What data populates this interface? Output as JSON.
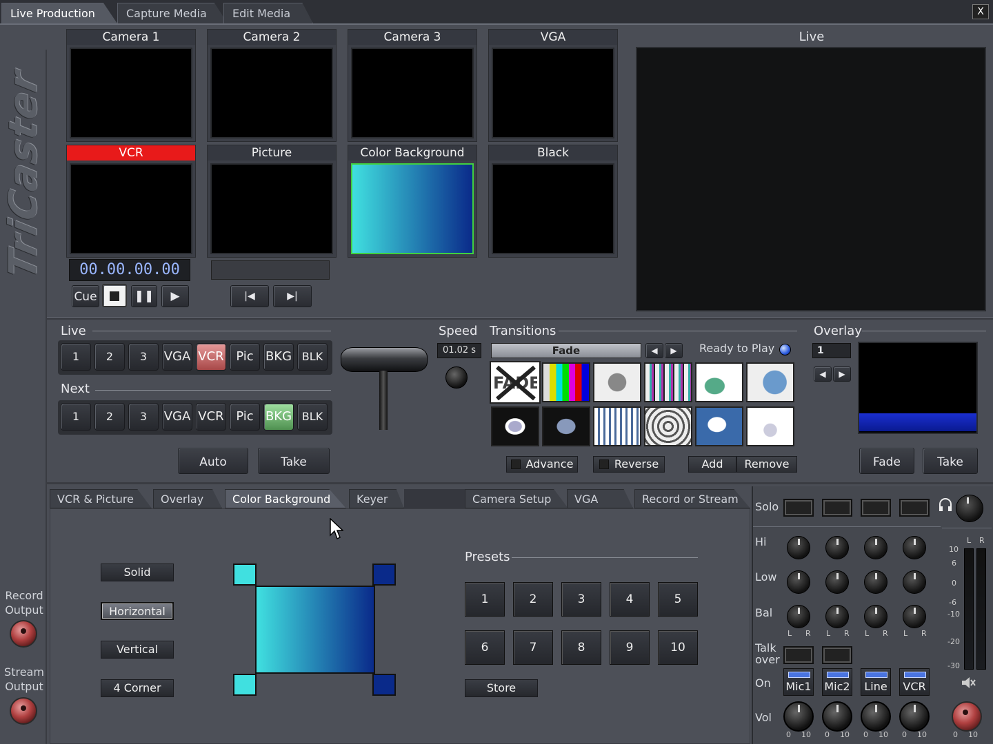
{
  "tabs": {
    "live_production": "Live Production",
    "capture_media": "Capture Media",
    "edit_media": "Edit Media",
    "close": "X"
  },
  "sidebar": {
    "logo": "TriCaster",
    "record_output": "Record\nOutput",
    "stream_output": "Stream\nOutput"
  },
  "monitors": {
    "camera1": "Camera 1",
    "camera2": "Camera 2",
    "camera3": "Camera 3",
    "vga": "VGA",
    "vcr": "VCR",
    "picture": "Picture",
    "color_background": "Color Background",
    "black": "Black",
    "live": "Live"
  },
  "vcr": {
    "timecode": "00.00.00.00",
    "cue": "Cue"
  },
  "live_row": {
    "label": "Live",
    "buttons": [
      "1",
      "2",
      "3",
      "VGA",
      "VCR",
      "Pic",
      "BKG",
      "BLK"
    ]
  },
  "next_row": {
    "label": "Next",
    "buttons": [
      "1",
      "2",
      "3",
      "VGA",
      "VCR",
      "Pic",
      "BKG",
      "BLK"
    ]
  },
  "actions": {
    "auto": "Auto",
    "take": "Take"
  },
  "speed": {
    "label": "Speed",
    "value": "01.02 s"
  },
  "transitions": {
    "label": "Transitions",
    "selected": "Fade",
    "status": "Ready to Play",
    "advance": "Advance",
    "reverse": "Reverse",
    "add": "Add",
    "remove": "Remove",
    "fade_thumb_text": "FADE"
  },
  "overlay": {
    "label": "Overlay",
    "value": "1",
    "fade": "Fade",
    "take": "Take"
  },
  "bottom_tabs": [
    "VCR & Picture",
    "Overlay",
    "Color Background",
    "Keyer",
    "Camera Setup",
    "VGA",
    "Record or Stream"
  ],
  "color_bg": {
    "types": [
      "Solid",
      "Horizontal",
      "Vertical",
      "4 Corner"
    ],
    "selected_type": "Horizontal",
    "colors": {
      "top_left": "#40e0e0",
      "top_right": "#0a2a8a",
      "bottom_left": "#40e0e0",
      "bottom_right": "#0a2a8a"
    }
  },
  "presets": {
    "label": "Presets",
    "buttons": [
      "1",
      "2",
      "3",
      "4",
      "5",
      "6",
      "7",
      "8",
      "9",
      "10"
    ],
    "store": "Store"
  },
  "audio": {
    "solo": "Solo",
    "hi": "Hi",
    "low": "Low",
    "bal": "Bal",
    "talkover": "Talk\nover",
    "on": "On",
    "vol": "Vol",
    "channels": [
      "Mic1",
      "Mic2",
      "Line",
      "VCR"
    ],
    "lr": [
      "L",
      "R"
    ],
    "vol_scale": [
      "0",
      "10"
    ],
    "meter_scale": [
      "10",
      "6",
      "0",
      "-6",
      "-10",
      "-20",
      "-30"
    ]
  }
}
